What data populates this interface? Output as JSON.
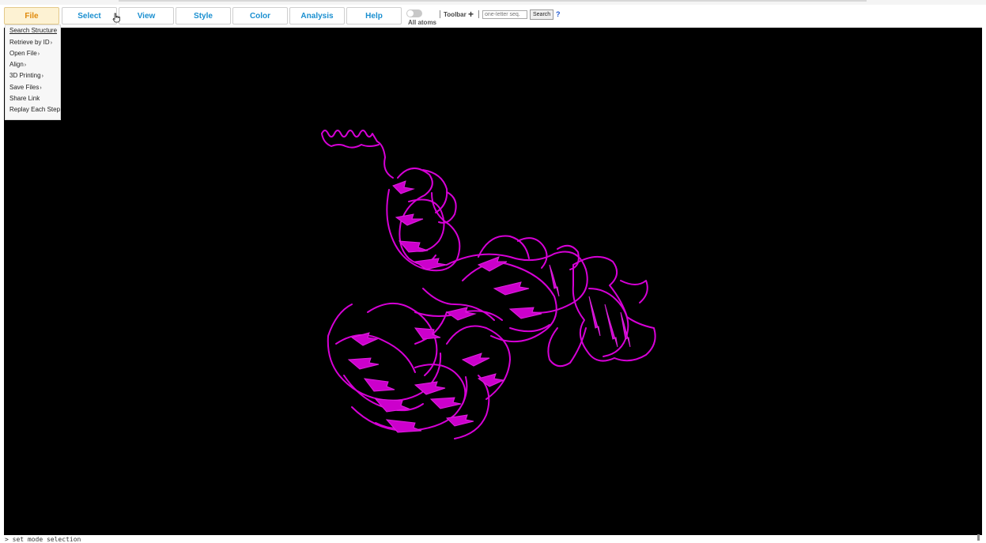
{
  "menu": {
    "file": "File",
    "select": "Select",
    "view": "View",
    "style": "Style",
    "color": "Color",
    "analysis": "Analysis",
    "help": "Help"
  },
  "toolbar": {
    "all_atoms_label": "All atoms",
    "toolbar_label": "Toolbar",
    "plus": "+",
    "sequence_placeholder": "one-letter seq.",
    "search_label": "Search",
    "help_q": "?"
  },
  "file_menu": {
    "items": [
      {
        "label": "Search Structure"
      },
      {
        "label": "Retrieve by ID"
      },
      {
        "label": "Open File"
      },
      {
        "label": "Align"
      },
      {
        "label": "3D Printing"
      },
      {
        "label": "Save Files"
      },
      {
        "label": "Share Link"
      },
      {
        "label": "Replay Each Step"
      }
    ]
  },
  "log": {
    "text": "> set mode selection"
  },
  "colors": {
    "ribbon": "#e000e0",
    "viewer_bg": "#000000",
    "menu_link": "#1a8fd0",
    "menu_active": "#e08a0b"
  },
  "icons": [
    "hand-cursor-icon",
    "plus-icon",
    "toggle-icon",
    "caret-right-icon"
  ]
}
